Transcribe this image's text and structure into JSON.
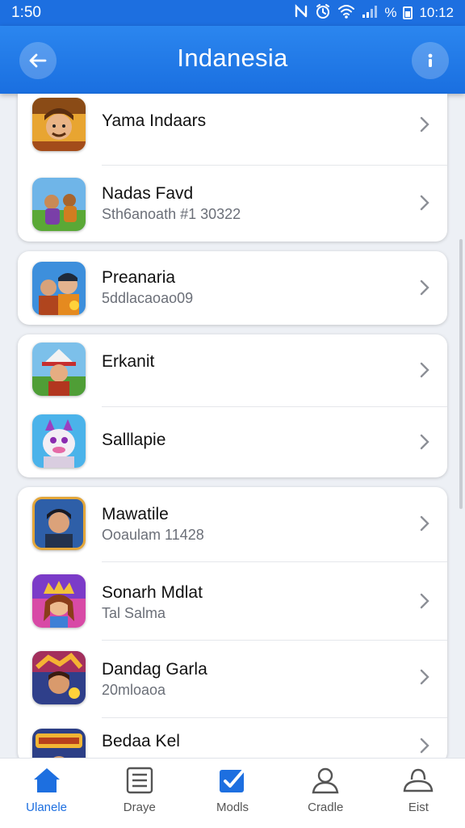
{
  "status_bar": {
    "time": "1:50",
    "battery_percent": "%",
    "clock_right": "10:12"
  },
  "app_bar": {
    "title": "Indanesia"
  },
  "colors": {
    "accent": "#1d6fe0",
    "background": "#edf0f5"
  },
  "groups": [
    {
      "items": [
        {
          "title": "Yama Indaars",
          "subtitle": "",
          "icon": "game-hero-icon"
        },
        {
          "title": "Nadas Favd",
          "subtitle": "Sth6anoath #1 30322",
          "icon": "game-field-icon"
        }
      ]
    },
    {
      "items": [
        {
          "title": "Preanaria",
          "subtitle": "5ddlacaoao09",
          "icon": "game-heroes-icon"
        }
      ]
    },
    {
      "items": [
        {
          "title": "Erkanit",
          "subtitle": "",
          "icon": "game-adventurer-icon"
        },
        {
          "title": "Salllapie",
          "subtitle": "",
          "icon": "game-creature-icon"
        }
      ]
    },
    {
      "items": [
        {
          "title": "Mawatile",
          "subtitle": "Ooaulam 11428",
          "icon": "game-portrait-icon"
        },
        {
          "title": "Sonarh Mdlat",
          "subtitle": "Tal Salma",
          "icon": "game-princess-icon"
        },
        {
          "title": "Dandag Garla",
          "subtitle": "20mloaoa",
          "icon": "game-warrior-icon"
        },
        {
          "title": "Bedaa Kel",
          "subtitle": "",
          "icon": "game-logo-icon"
        }
      ]
    }
  ],
  "bottom_nav": [
    {
      "label": "Ulanele",
      "icon": "home-icon",
      "active": true
    },
    {
      "label": "Draye",
      "icon": "list-icon",
      "active": false
    },
    {
      "label": "Modls",
      "icon": "checkbox-icon",
      "active": false
    },
    {
      "label": "Cradle",
      "icon": "person-icon",
      "active": false
    },
    {
      "label": "Eist",
      "icon": "profile-icon",
      "active": false
    }
  ]
}
